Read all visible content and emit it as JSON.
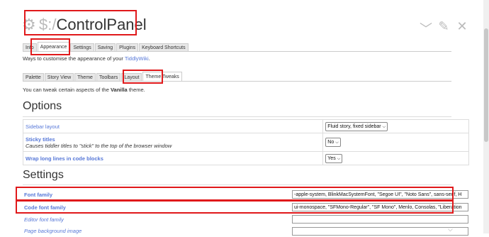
{
  "header": {
    "prefix": "$:/",
    "title": "ControlPanel",
    "gear_icon": "gear-icon"
  },
  "toolbar": {
    "collapse": "﹀",
    "edit": "✎",
    "close": "✕"
  },
  "main_tabs": [
    "Info",
    "Appearance",
    "Settings",
    "Saving",
    "Plugins",
    "Keyboard Shortcuts"
  ],
  "main_tabs_active": "Appearance",
  "appearance_desc": {
    "before": "Ways to customise the appearance of your ",
    "link": "TiddlyWiki",
    "after": "."
  },
  "sub_tabs": [
    "Palette",
    "Story View",
    "Theme",
    "Toolbars",
    "Layout",
    "Theme Tweaks"
  ],
  "sub_tabs_active": "Theme Tweaks",
  "tweaks_desc": {
    "before": "You can tweak certain aspects of the ",
    "theme": "Vanilla",
    "after": " theme."
  },
  "options": {
    "heading": "Options",
    "rows": [
      {
        "label": "Sidebar layout",
        "sub": "",
        "value": "Fluid story, fixed sidebar"
      },
      {
        "label": "Sticky titles",
        "sub": "Causes tiddler titles to \"stick\" to the top of the browser window",
        "value": "No"
      },
      {
        "label": "Wrap long lines in code blocks",
        "sub": "",
        "value": "Yes"
      }
    ]
  },
  "settings": {
    "heading": "Settings",
    "rows": [
      {
        "label": "Font family",
        "value": "-apple-system, BlinkMacSystemFont, \"Segoe UI\", \"Noto Sans\", sans-serif, H"
      },
      {
        "label": "Code font family",
        "value": "ui-monospace, \"SFMono-Regular\", \"SF Mono\", Menlo, Consolas, \"Liberation"
      },
      {
        "label": "Editor font family",
        "value": ""
      },
      {
        "label": "Page background image",
        "value": ""
      }
    ]
  },
  "colors": {
    "highlight": "#e0191b",
    "link": "#5778d8"
  }
}
